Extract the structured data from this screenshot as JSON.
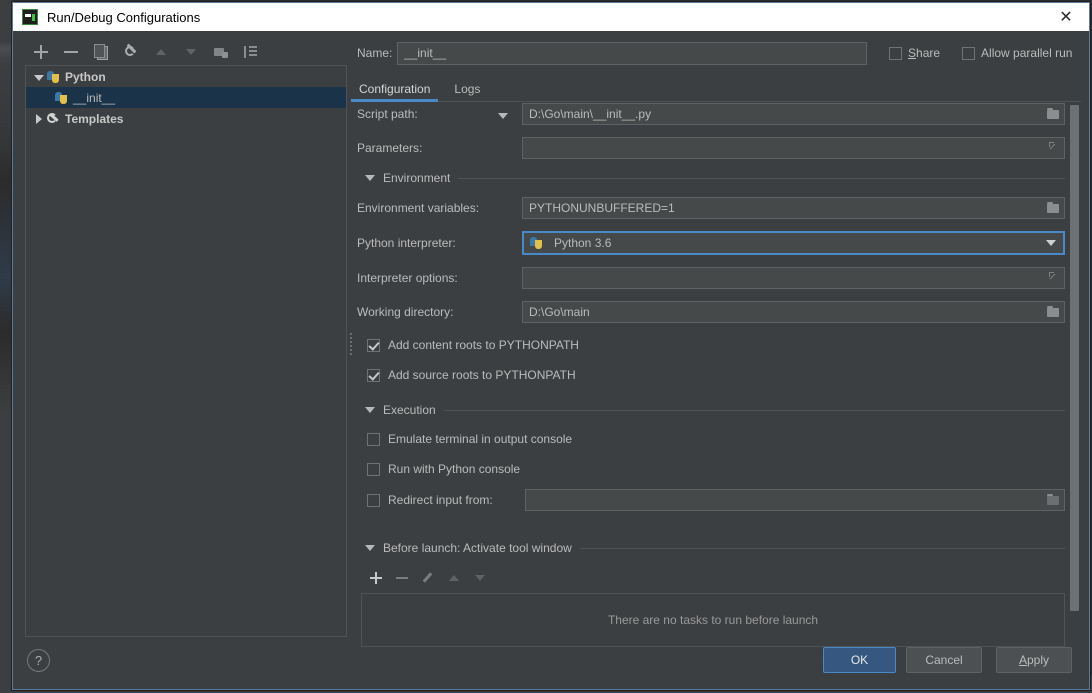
{
  "window": {
    "title": "Run/Debug Configurations",
    "app_icon": "pycharm-icon",
    "close_label": "✕"
  },
  "tree_toolbar": [
    {
      "name": "add-configuration-button",
      "icon": "plus-icon",
      "enabled": true
    },
    {
      "name": "remove-configuration-button",
      "icon": "minus-icon",
      "enabled": true
    },
    {
      "name": "copy-configuration-button",
      "icon": "copy-icon",
      "enabled": true
    },
    {
      "name": "edit-templates-button",
      "icon": "wrench-icon",
      "enabled": true
    },
    {
      "name": "move-up-button",
      "icon": "arrow-up-icon",
      "enabled": false
    },
    {
      "name": "move-down-button",
      "icon": "arrow-down-icon",
      "enabled": false
    },
    {
      "name": "move-into-folder-button",
      "icon": "folder-add-icon",
      "enabled": true
    },
    {
      "name": "sort-configurations-button",
      "icon": "sort-icon",
      "enabled": true
    }
  ],
  "tree": {
    "items": [
      {
        "label": "Python",
        "icon": "python-icon",
        "twisty": "expanded",
        "depth": 0,
        "bold": true,
        "selected": false
      },
      {
        "label": "__init__",
        "icon": "python-icon",
        "twisty": "none",
        "depth": 1,
        "bold": false,
        "selected": true
      },
      {
        "label": "Templates",
        "icon": "wrench-icon",
        "twisty": "collapsed",
        "depth": 0,
        "bold": true,
        "selected": false
      }
    ]
  },
  "header": {
    "name_label": "Name:",
    "name_value": "__init__",
    "share": {
      "label_pre": "S",
      "label_post": "hare",
      "checked": false
    },
    "allow_parallel": {
      "label": "Allow parallel run",
      "checked": false
    }
  },
  "tabs": [
    {
      "label": "Configuration",
      "active": true
    },
    {
      "label": "Logs",
      "active": false
    }
  ],
  "form": {
    "script_path": {
      "label": "Script path:",
      "value": "D:\\Go\\main\\__init__.py",
      "has_label_caret": true,
      "browse_icon": "folder-browse-icon"
    },
    "parameters": {
      "label": "Parameters:",
      "value": "",
      "expand_icon": "expand-editor-icon"
    },
    "environment_section": {
      "title": "Environment",
      "expanded": true
    },
    "environment_variables": {
      "label": "Environment variables:",
      "value": "PYTHONUNBUFFERED=1",
      "browse_icon": "folder-browse-icon"
    },
    "python_interpreter": {
      "label": "Python interpreter:",
      "value": "Python 3.6",
      "icon": "python-icon",
      "focused": true,
      "dropdown_icon": "chevron-down-icon"
    },
    "interpreter_options": {
      "label": "Interpreter options:",
      "value": "",
      "expand_icon": "expand-editor-icon"
    },
    "working_directory": {
      "label": "Working directory:",
      "value": "D:\\Go\\main",
      "browse_icon": "folder-browse-icon"
    },
    "checkboxes": [
      {
        "label": "Add content roots to PYTHONPATH",
        "checked": true,
        "name": "add-content-roots-checkbox"
      },
      {
        "label": "Add source roots to PYTHONPATH",
        "checked": true,
        "name": "add-source-roots-checkbox"
      }
    ],
    "execution_section": {
      "title": "Execution",
      "expanded": true
    },
    "execution_checkboxes": [
      {
        "label": "Emulate terminal in output console",
        "checked": false,
        "name": "emulate-terminal-checkbox"
      },
      {
        "label": "Run with Python console",
        "checked": false,
        "name": "run-with-python-console-checkbox"
      }
    ],
    "redirect_input": {
      "label": "Redirect input from:",
      "checked": false,
      "value": "",
      "browse_icon": "folder-browse-icon"
    }
  },
  "before_launch": {
    "section_title": "Before launch: Activate tool window",
    "expanded": true,
    "toolbar": [
      {
        "name": "before-launch-add-button",
        "icon": "plus-icon",
        "enabled": true
      },
      {
        "name": "before-launch-remove-button",
        "icon": "minus-icon",
        "enabled": false
      },
      {
        "name": "before-launch-edit-button",
        "icon": "pencil-icon",
        "enabled": false
      },
      {
        "name": "before-launch-move-up-button",
        "icon": "arrow-up-icon",
        "enabled": false
      },
      {
        "name": "before-launch-move-down-button",
        "icon": "arrow-down-icon",
        "enabled": false
      }
    ],
    "empty_text": "There are no tasks to run before launch"
  },
  "buttons": {
    "help": "?",
    "ok": "OK",
    "cancel": "Cancel",
    "apply_pre": "A",
    "apply_post": "pply"
  },
  "colors": {
    "accent": "#4a88c7",
    "default_button": "#365880",
    "panel": "#3c3f41",
    "field": "#45494a",
    "selection": "#1b3348",
    "text": "#bbbbbb"
  }
}
